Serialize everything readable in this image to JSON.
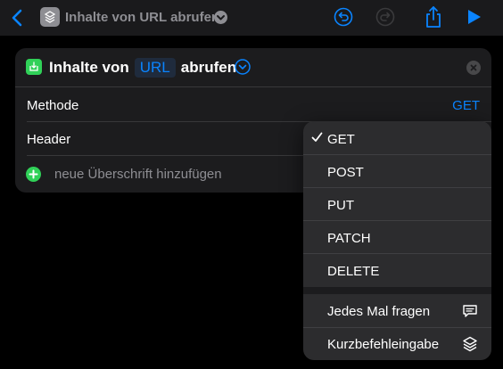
{
  "toolbar": {
    "title": "Inhalte von URL abrufen"
  },
  "action": {
    "title_prefix": "Inhalte von",
    "param_chip": "URL",
    "title_suffix": "abrufen",
    "method_label": "Methode",
    "method_value": "GET",
    "header_label": "Header",
    "add_header_label": "neue Überschrift hinzufügen"
  },
  "method_menu": {
    "selected": "GET",
    "items": [
      {
        "label": "GET"
      },
      {
        "label": "POST"
      },
      {
        "label": "PUT"
      },
      {
        "label": "PATCH"
      },
      {
        "label": "DELETE"
      }
    ],
    "extra_items": [
      {
        "label": "Jedes Mal fragen",
        "icon": "speech-bubble-icon"
      },
      {
        "label": "Kurzbefehleingabe",
        "icon": "shortcuts-layers-icon"
      }
    ]
  },
  "colors": {
    "accent": "#0a84ff",
    "green": "#30d158",
    "card": "#1c1c1e",
    "menu": "#2c2c2e"
  }
}
